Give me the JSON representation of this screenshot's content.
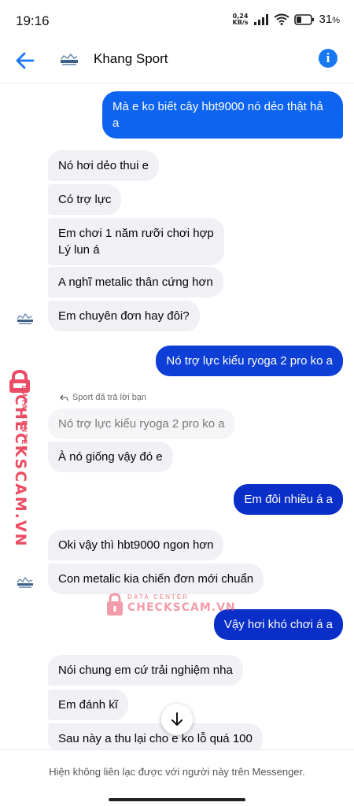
{
  "status_bar": {
    "time": "19:16",
    "net_speed_value": "0,24",
    "net_speed_unit": "KB/s",
    "battery": "31",
    "battery_unit": "%"
  },
  "header": {
    "contact_name": "Khang Sport",
    "accent_color": "#1877f2"
  },
  "messages": [
    {
      "side": "out",
      "lines": [
        "Mà e ko biết cây hbt9000 nó dẻo thật hả",
        "a"
      ]
    },
    {
      "side": "in",
      "text": "Nó hơi dẻo thui e"
    },
    {
      "side": "in",
      "text": "Có trợ lực"
    },
    {
      "side": "in",
      "lines": [
        "Em chơi 1 năm rưỡi chơi hợp",
        "Lý lun á"
      ]
    },
    {
      "side": "in",
      "text": "A nghĩ metalic thân cứng hơn"
    },
    {
      "side": "in",
      "text": "Em chuyên đơn hay đôi?"
    },
    {
      "side": "out",
      "text": "Nó trợ lực kiểu ryoga 2 pro ko a"
    },
    {
      "side": "in",
      "reply_note": "Sport đã trả lời bạn",
      "quoted": "Nó trợ lực kiểu ryoga 2 pro ko a",
      "text": "À nó giống vậy đó e"
    },
    {
      "side": "out",
      "text": "Em đôi nhiều á a"
    },
    {
      "side": "in",
      "text": "Oki vậy thì hbt9000 ngon hơn"
    },
    {
      "side": "in",
      "text": "Con metalic kia chiến đơn mới chuẩn"
    },
    {
      "side": "out",
      "text": "Vậy hơi khó chơi á a"
    },
    {
      "side": "in",
      "text": "Nói chung em cứ trải nghiệm nha"
    },
    {
      "side": "in",
      "text": "Em đánh kĩ"
    },
    {
      "side": "in",
      "text": "Sau này a thu lại cho e ko lỗ quá 100"
    }
  ],
  "watermark": {
    "top_text": "DATA CENTER",
    "main_text": "CHECKSCAM.VN",
    "color": "#ea4d64"
  },
  "footer": {
    "notice": "Hiện không liên lạc được với người này trên Messenger."
  },
  "icons": {
    "back": "arrow-left-icon",
    "info": "info-icon",
    "scroll": "arrow-down-icon"
  }
}
